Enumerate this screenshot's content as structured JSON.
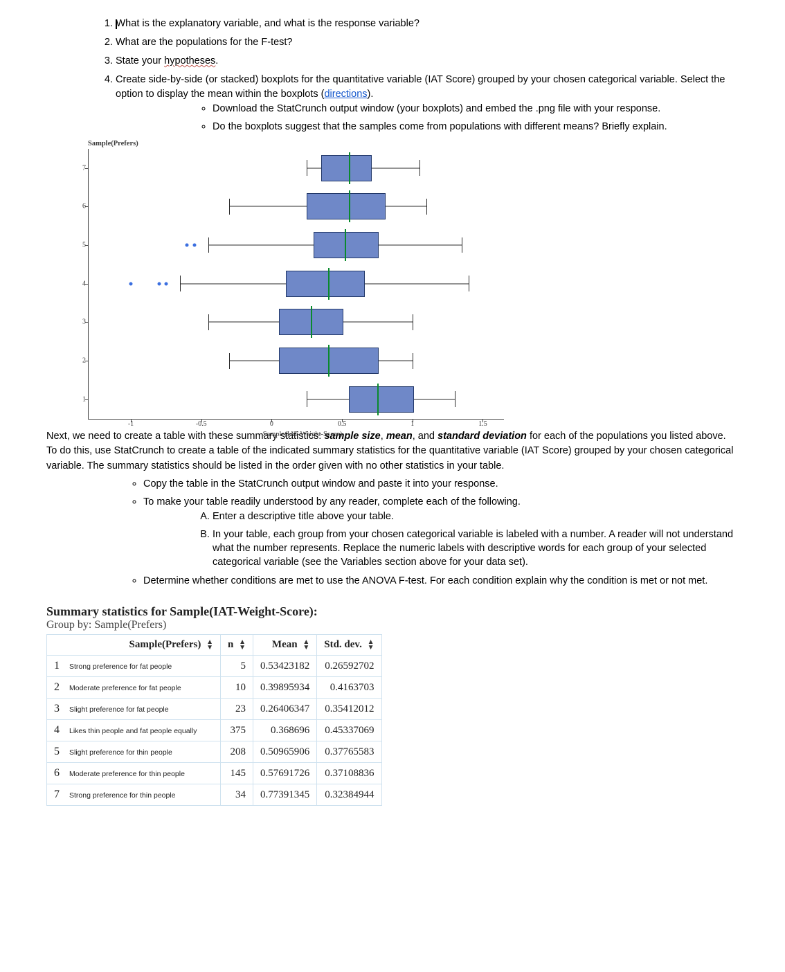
{
  "questions": {
    "q1": "What is the explanatory variable, and what is the response variable?",
    "q2": "What are the populations for the F-test?",
    "q3_pre": "State your ",
    "q3_wavy": "hypotheses",
    "q3_post": ".",
    "q4_a": "Create side-by-side (or stacked) boxplots for the quantitative variable (IAT Score) grouped by your chosen categorical variable. Select the option to display the mean within the boxplots (",
    "q4_link": "directions",
    "q4_b": ").",
    "q4_sub1": "Download the StatCrunch output window (your boxplots) and embed the .png file with your response.",
    "q4_sub2": "Do the boxplots suggest that the samples come from populations with different means? Briefly explain."
  },
  "chart_data": {
    "type": "boxplot-horizontal",
    "title": "Sample(Prefers)",
    "xlabel": "Sample(IAT-Weight-Score)",
    "xlim": [
      -1.3,
      1.65
    ],
    "xticks": [
      -1,
      -0.5,
      0,
      0.5,
      1,
      1.5
    ],
    "ylim": [
      0.5,
      7.5
    ],
    "yticks": [
      1,
      2,
      3,
      4,
      5,
      6,
      7
    ],
    "rows": [
      {
        "y": 7,
        "whisker": [
          0.25,
          1.05
        ],
        "box": [
          0.35,
          0.55,
          0.7
        ],
        "outliers": []
      },
      {
        "y": 6,
        "whisker": [
          -0.3,
          1.1
        ],
        "box": [
          0.25,
          0.55,
          0.8
        ],
        "outliers": []
      },
      {
        "y": 5,
        "whisker": [
          -0.45,
          1.35
        ],
        "box": [
          0.3,
          0.52,
          0.75
        ],
        "outliers": [
          -0.6,
          -0.55
        ]
      },
      {
        "y": 4,
        "whisker": [
          -0.65,
          1.4
        ],
        "box": [
          0.1,
          0.4,
          0.65
        ],
        "outliers": [
          -1.0,
          -0.8,
          -0.75
        ]
      },
      {
        "y": 3,
        "whisker": [
          -0.45,
          1.0
        ],
        "box": [
          0.05,
          0.28,
          0.5
        ],
        "outliers": []
      },
      {
        "y": 2,
        "whisker": [
          -0.3,
          1.0
        ],
        "box": [
          0.05,
          0.4,
          0.75
        ],
        "outliers": []
      },
      {
        "y": 1,
        "whisker": [
          0.25,
          1.3
        ],
        "box": [
          0.55,
          0.75,
          1.0
        ],
        "outliers": []
      }
    ]
  },
  "after_chart": {
    "p_a": "Next, we need to create a table with these summary statistics: ",
    "em1": "sample size",
    "sep": ", ",
    "em2": "mean",
    "and": ", and ",
    "em3": "standard deviation",
    "p_b": " for each of the populations you listed above. To do this, use StatCrunch to create a table of the indicated summary statistics for the quantitative variable (IAT Score) grouped by your chosen categorical variable. The summary statistics should be listed in the order given with no other statistics in your table.",
    "s1": "Copy the table in the StatCrunch output window and paste it into your response.",
    "s2": "To make your table readily understood by any reader, complete each of the following.",
    "a": "Enter a descriptive title above your table.",
    "b": "In your table, each group from your chosen categorical variable is labeled with a number. A reader will not understand what the number represents. Replace the numeric labels with descriptive words for each group of your selected categorical variable (see the Variables section above for your data set).",
    "s3": "Determine whether conditions are met to use the ANOVA F-test. For each condition explain why the condition is met or not met."
  },
  "table": {
    "title": "Summary statistics for Sample(IAT-Weight-Score):",
    "subtitle": "Group by: Sample(Prefers)",
    "headers": {
      "c1": "Sample(Prefers)",
      "c2": "n",
      "c3": "Mean",
      "c4": "Std. dev."
    },
    "rows": [
      {
        "i": "1",
        "label": "Strong preference for fat people",
        "n": "5",
        "mean": "0.53423182",
        "sd": "0.26592702"
      },
      {
        "i": "2",
        "label": "Moderate preference for fat people",
        "n": "10",
        "mean": "0.39895934",
        "sd": "0.4163703"
      },
      {
        "i": "3",
        "label": "Slight preference for fat people",
        "n": "23",
        "mean": "0.26406347",
        "sd": "0.35412012"
      },
      {
        "i": "4",
        "label": "Likes thin people and fat people equally",
        "n": "375",
        "mean": "0.368696",
        "sd": "0.45337069"
      },
      {
        "i": "5",
        "label": "Slight preference for thin people",
        "n": "208",
        "mean": "0.50965906",
        "sd": "0.37765583"
      },
      {
        "i": "6",
        "label": "Moderate preference for thin people",
        "n": "145",
        "mean": "0.57691726",
        "sd": "0.37108836"
      },
      {
        "i": "7",
        "label": "Strong preference for thin people",
        "n": "34",
        "mean": "0.77391345",
        "sd": "0.32384944"
      }
    ]
  }
}
